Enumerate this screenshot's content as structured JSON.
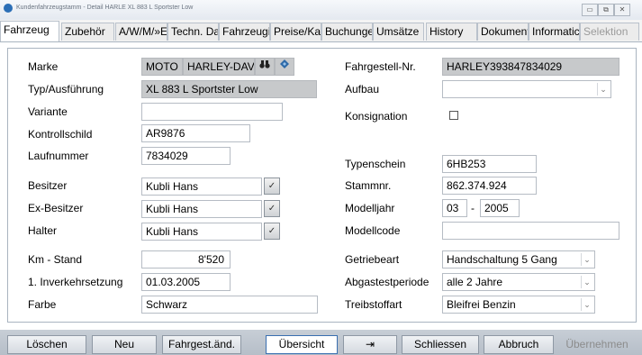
{
  "window": {
    "title": "Kundenfahrzeugstamm - Detail HARLE XL 883 L Sportster Low",
    "controls": [
      "▭",
      "⧉",
      "✕"
    ]
  },
  "tabs": [
    {
      "label": "Fahrzeug",
      "active": true
    },
    {
      "label": "Zubehör"
    },
    {
      "label": "A/W/M/»E"
    },
    {
      "label": "Techn. Da"
    },
    {
      "label": "Fahrzeugi"
    },
    {
      "label": "Preise/Ka"
    },
    {
      "label": "Buchunge"
    },
    {
      "label": "Umsätze"
    },
    {
      "label": "History"
    },
    {
      "label": "Dokument"
    },
    {
      "label": "Informatic"
    },
    {
      "label": "Selektion",
      "disabled": true
    }
  ],
  "left": {
    "marke": {
      "label": "Marke",
      "value1": "MOTO",
      "value2": "HARLEY-DAV"
    },
    "typ": {
      "label": "Typ/Ausführung",
      "value": "XL 883 L Sportster Low"
    },
    "variante": {
      "label": "Variante",
      "value": ""
    },
    "kontrollschild": {
      "label": "Kontrollschild",
      "value": "AR9876"
    },
    "laufnummer": {
      "label": "Laufnummer",
      "value": "7834029"
    },
    "besitzer": {
      "label": "Besitzer",
      "value": "Kubli Hans"
    },
    "ex_besitzer": {
      "label": "Ex-Besitzer",
      "value": "Kubli Hans"
    },
    "halter": {
      "label": "Halter",
      "value": "Kubli Hans"
    },
    "km_stand": {
      "label": "Km - Stand",
      "value": "8'520"
    },
    "inverkehrsetzung": {
      "label": "1. Inverkehrsetzung",
      "value": "01.03.2005"
    },
    "farbe": {
      "label": "Farbe",
      "value": "Schwarz"
    }
  },
  "right": {
    "fahrgestell": {
      "label": "Fahrgestell-Nr.",
      "value": "HARLEY393847834029"
    },
    "aufbau": {
      "label": "Aufbau",
      "value": ""
    },
    "konsignation": {
      "label": "Konsignation",
      "checked": false
    },
    "typenschein": {
      "label": "Typenschein",
      "value": "6HB253"
    },
    "stammnr": {
      "label": "Stammnr.",
      "value": "862.374.924"
    },
    "modelljahr": {
      "label": "Modelljahr",
      "month": "03",
      "separator": "-",
      "year": "2005"
    },
    "modellcode": {
      "label": "Modellcode",
      "value": ""
    },
    "getriebeart": {
      "label": "Getriebeart",
      "value": "Handschaltung 5 Gang"
    },
    "abgastest": {
      "label": "Abgastestperiode",
      "value": "alle 2 Jahre"
    },
    "treibstoff": {
      "label": "Treibstoffart",
      "value": "Bleifrei Benzin"
    }
  },
  "buttons": {
    "loeschen": "Löschen",
    "neu": "Neu",
    "fahrgest": "Fahrgest.änd.",
    "uebersicht": "Übersicht",
    "pin": "⇥",
    "schliessen": "Schliessen",
    "abbruch": "Abbruch",
    "uebernehmen": "Übernehmen"
  },
  "icons": {
    "binoculars": "binoculars-icon",
    "diamond": "diamond-icon",
    "lookup": "lookup-icon",
    "dropdown": "chevron-down-icon"
  }
}
